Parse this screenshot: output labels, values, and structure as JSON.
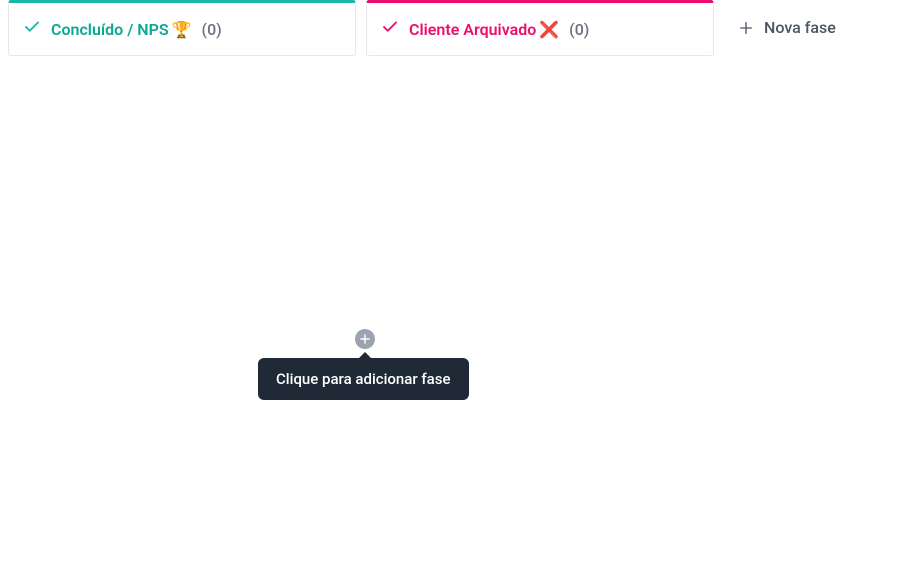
{
  "columns": [
    {
      "accent": "teal",
      "check_color": "#17b7a6",
      "title": "Concluído / NPS",
      "emoji": "🏆",
      "count": "(0)"
    },
    {
      "accent": "pink",
      "check_color": "#ec0e6e",
      "title": "Cliente Arquivado",
      "emoji": "❌",
      "count": "(0)"
    }
  ],
  "new_phase_label": "Nova fase",
  "insert_tooltip": "Clique para adicionar fase"
}
